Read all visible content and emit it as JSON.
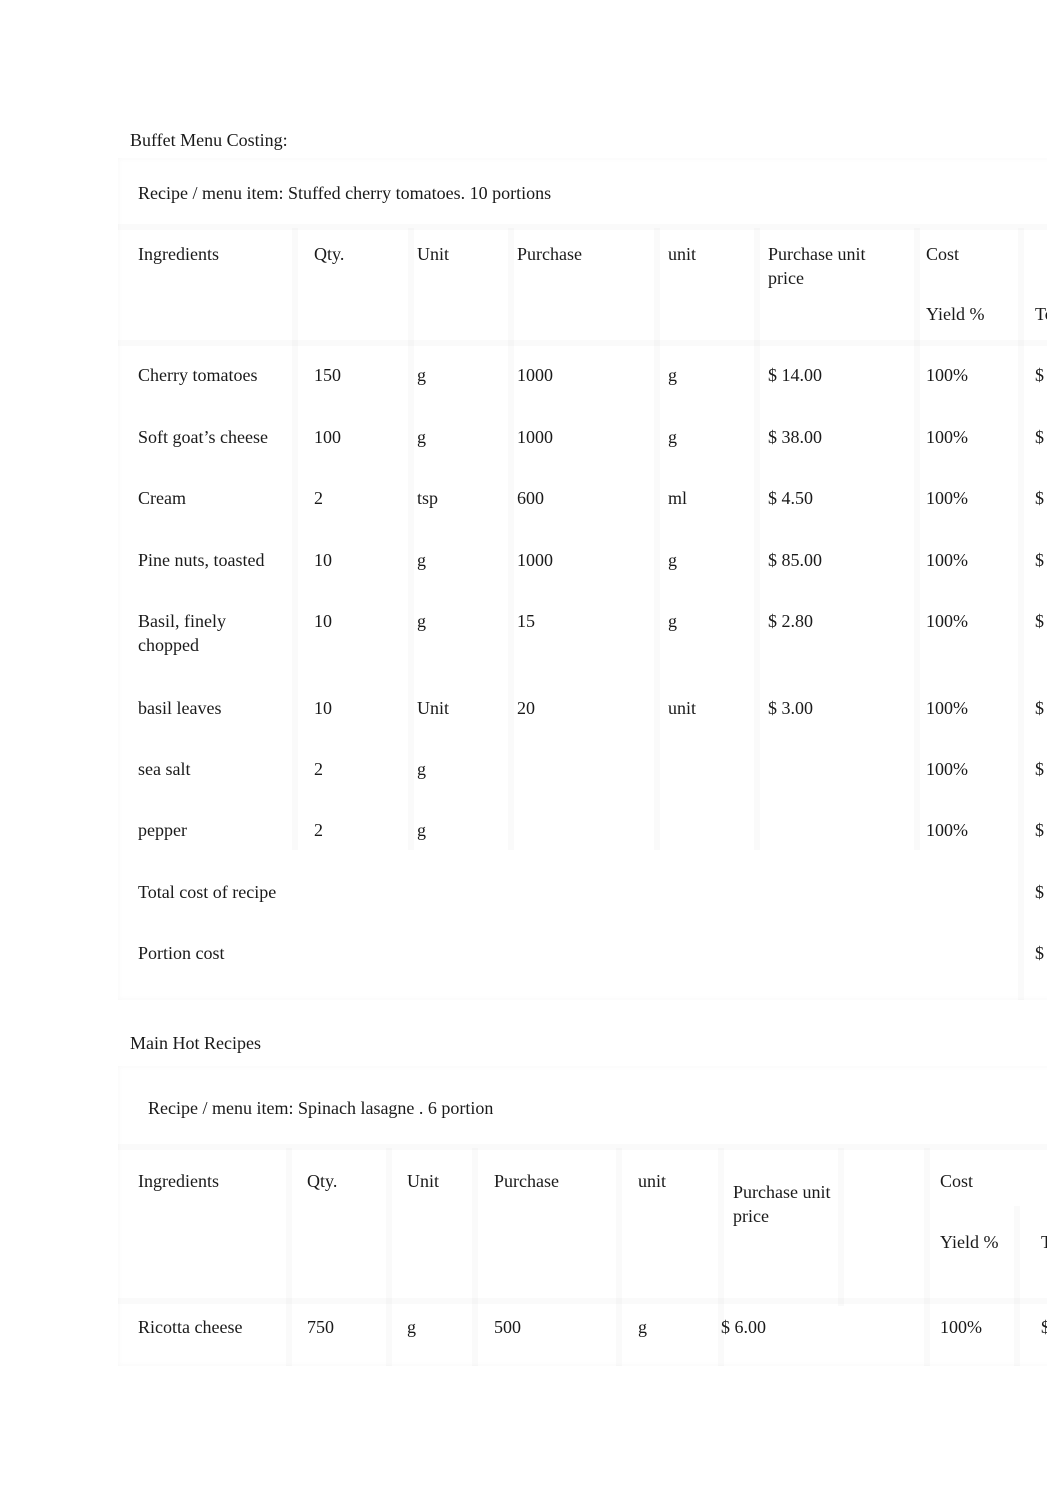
{
  "section1": {
    "heading": "Buffet Menu Costing:",
    "recipe_title": "Recipe / menu item: Stuffed cherry tomatoes. 10 portions",
    "headers": {
      "ingredients": "Ingredients",
      "qty": "Qty.",
      "unit": "Unit",
      "purchase": "Purchase",
      "purchase_unit": "unit",
      "purchase_unit_price": "Purchase unit price",
      "cost": "Cost",
      "yield": "Yield %",
      "total_truncated": "To"
    },
    "rows": [
      {
        "ingredient": "Cherry tomatoes",
        "qty": "150",
        "unit": "g",
        "purchase": "1000",
        "purchase_unit": "g",
        "price": "$ 14.00",
        "yield": "100%",
        "total": "$"
      },
      {
        "ingredient": "Soft goat’s cheese",
        "qty": "100",
        "unit": "g",
        "purchase": "1000",
        "purchase_unit": "g",
        "price": "$ 38.00",
        "yield": "100%",
        "total": "$"
      },
      {
        "ingredient": "Cream",
        "qty": "2",
        "unit": "tsp",
        "purchase": "600",
        "purchase_unit": "ml",
        "price": "$ 4.50",
        "yield": "100%",
        "total": "$"
      },
      {
        "ingredient": "Pine nuts, toasted",
        "qty": "10",
        "unit": "g",
        "purchase": "1000",
        "purchase_unit": "g",
        "price": "$ 85.00",
        "yield": "100%",
        "total": "$"
      },
      {
        "ingredient": "Basil, finely chopped",
        "qty": "10",
        "unit": "g",
        "purchase": "15",
        "purchase_unit": "g",
        "price": "$ 2.80",
        "yield": "100%",
        "total": "$"
      },
      {
        "ingredient": "basil leaves",
        "qty": "10",
        "unit": "Unit",
        "purchase": "20",
        "purchase_unit": "unit",
        "price": "$ 3.00",
        "yield": "100%",
        "total": "$"
      },
      {
        "ingredient": "sea salt",
        "qty": "2",
        "unit": "g",
        "purchase": "",
        "purchase_unit": "",
        "price": "",
        "yield": "100%",
        "total": "$"
      },
      {
        "ingredient": "pepper",
        "qty": "2",
        "unit": "g",
        "purchase": "",
        "purchase_unit": "",
        "price": "",
        "yield": "100%",
        "total": "$"
      }
    ],
    "total_cost_label": "Total cost of recipe",
    "total_cost_value": "$",
    "portion_cost_label": "Portion cost",
    "portion_cost_value": "$"
  },
  "section2": {
    "heading": "Main Hot Recipes",
    "recipe_title": "Recipe / menu item: Spinach lasagne . 6 portion",
    "headers": {
      "ingredients": "Ingredients",
      "qty": "Qty.",
      "unit": "Unit",
      "purchase": "Purchase",
      "purchase_unit": "unit",
      "purchase_unit_price": "Purchase unit price",
      "cost": "Cost",
      "yield": "Yield %",
      "total_truncated": "T"
    },
    "rows": [
      {
        "ingredient": "Ricotta cheese",
        "qty": "750",
        "unit": "g",
        "purchase": "500",
        "purchase_unit": "g",
        "price": "$ 6.00",
        "yield": "100%",
        "total": "$"
      }
    ]
  }
}
